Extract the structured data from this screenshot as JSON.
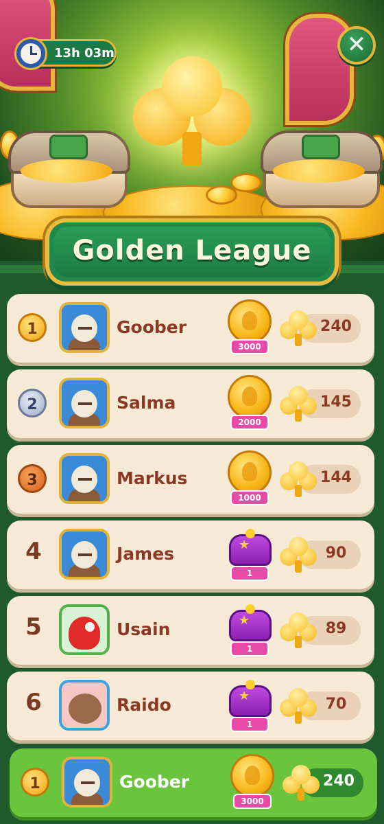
{
  "timer": {
    "label": "13h 03m",
    "icon": "clock-icon"
  },
  "close": {
    "label": "✕",
    "icon": "close-icon"
  },
  "league": {
    "title": "Golden League",
    "icon": "golden-club-icon"
  },
  "leaderboard": [
    {
      "rank": "1",
      "rank_style": "gold",
      "name": "Goober",
      "avatar": "sheep",
      "reward_type": "coins",
      "reward": "3000",
      "score": "240"
    },
    {
      "rank": "2",
      "rank_style": "silver",
      "name": "Salma",
      "avatar": "sheep",
      "reward_type": "coins",
      "reward": "2000",
      "score": "145"
    },
    {
      "rank": "3",
      "rank_style": "bronze",
      "name": "Markus",
      "avatar": "sheep",
      "reward_type": "coins",
      "reward": "1000",
      "score": "144"
    },
    {
      "rank": "4",
      "rank_style": "plain",
      "name": "James",
      "avatar": "sheep",
      "reward_type": "chest",
      "reward": "1",
      "score": "90"
    },
    {
      "rank": "5",
      "rank_style": "plain",
      "name": "Usain",
      "avatar": "parrot",
      "reward_type": "chest",
      "reward": "1",
      "score": "89"
    },
    {
      "rank": "6",
      "rank_style": "plain",
      "name": "Raido",
      "avatar": "otter",
      "reward_type": "chest",
      "reward": "1",
      "score": "70"
    }
  ],
  "player": {
    "rank": "1",
    "name": "Goober",
    "avatar": "sheep",
    "reward": "3000",
    "score": "240"
  },
  "colors": {
    "panel_green": "#1f5a2c",
    "title_green": "#20884b",
    "gold_border": "#e9bb40",
    "row_bg": "#f6ead7",
    "player_row": "#6ac43c",
    "name_text": "#8a3a24"
  }
}
